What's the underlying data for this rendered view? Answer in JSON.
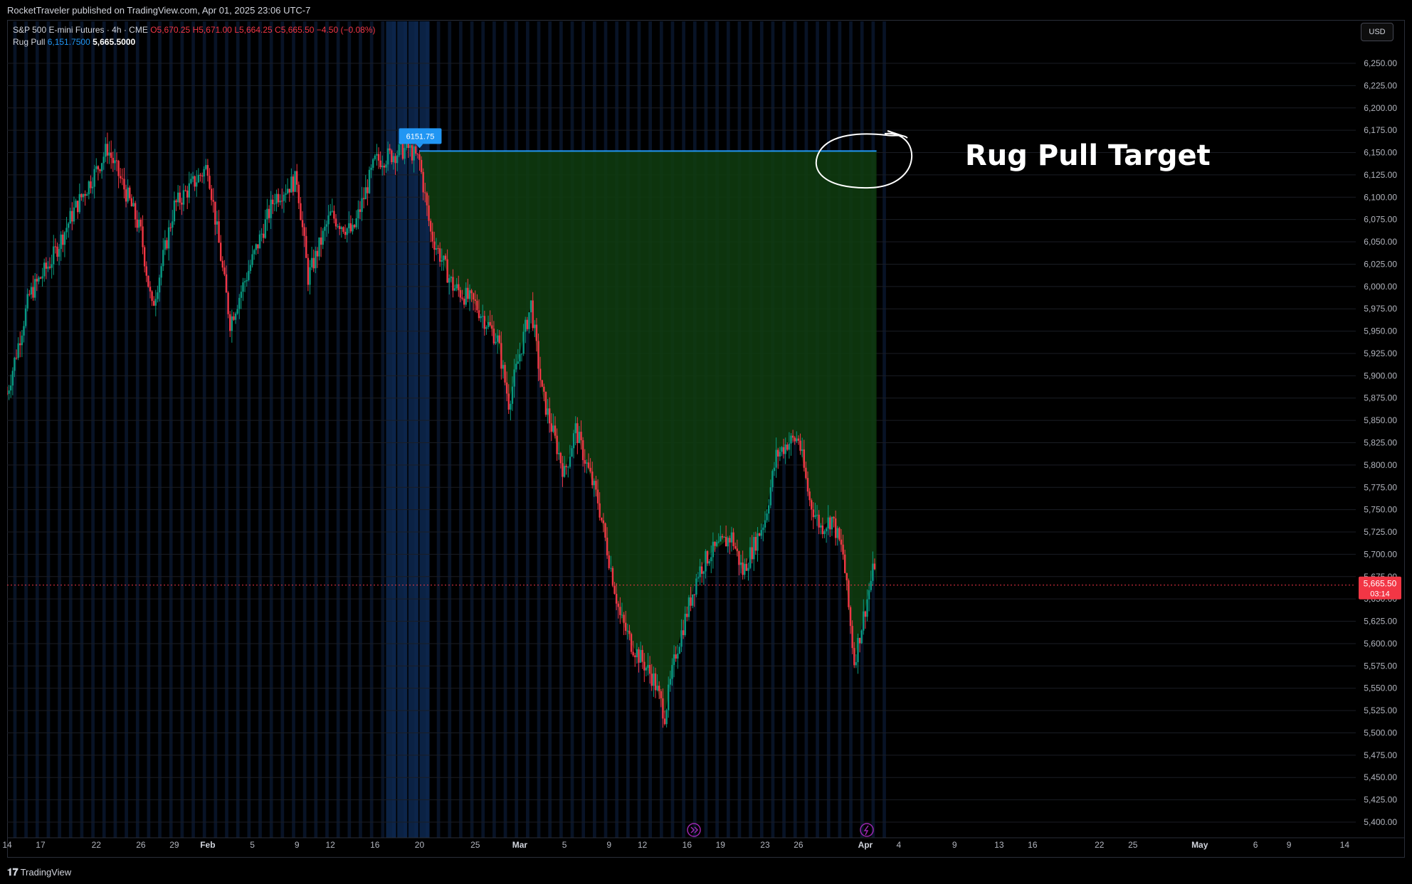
{
  "header": {
    "publish_line": "RocketTraveler published on TradingView.com, Apr 01, 2025 23:06 UTC-7"
  },
  "legend": {
    "symbol": "S&P 500 E-mini Futures · 4h · CME",
    "open": "O5,670.25",
    "high": "H5,671.00",
    "low": "L5,664.25",
    "close": "C5,665.50",
    "change": "−4.50 (−0.08%)",
    "indicator_name": "Rug Pull",
    "indicator_value_1": "6,151.7500",
    "indicator_value_2": "5,665.5000"
  },
  "currency_button": "USD",
  "footer": {
    "logo_text": "TradingView"
  },
  "colors": {
    "up": "#089981",
    "down": "#f23645",
    "level_line": "#2196f3",
    "fill": "#0f3d0f",
    "background": "#000000",
    "bands": "#0b1a33"
  },
  "icons": [
    "replay-icon",
    "lightning-icon",
    "tradingview-logo-icon"
  ],
  "chart_data": {
    "type": "candlestick",
    "symbol": "S&P 500 E-mini Futures",
    "timeframe": "4h",
    "exchange": "CME",
    "y_axis": {
      "ticks": [
        "5,400.00",
        "5,425.00",
        "5,450.00",
        "5,475.00",
        "5,500.00",
        "5,525.00",
        "5,550.00",
        "5,575.00",
        "5,600.00",
        "5,625.00",
        "5,650.00",
        "5,675.00",
        "5,700.00",
        "5,725.00",
        "5,750.00",
        "5,775.00",
        "5,800.00",
        "5,825.00",
        "5,850.00",
        "5,875.00",
        "5,900.00",
        "5,925.00",
        "5,950.00",
        "5,975.00",
        "6,000.00",
        "6,025.00",
        "6,050.00",
        "6,075.00",
        "6,100.00",
        "6,125.00",
        "6,150.00",
        "6,175.00",
        "6,200.00",
        "6,225.00",
        "6,250.00"
      ],
      "range": [
        5392,
        6272
      ],
      "position": "right"
    },
    "x_axis": {
      "ticks": [
        "14",
        "17",
        "22",
        "26",
        "29",
        "Feb",
        "5",
        "9",
        "12",
        "16",
        "20",
        "25",
        "Mar",
        "5",
        "9",
        "12",
        "16",
        "19",
        "23",
        "26",
        "Apr",
        "4",
        "9",
        "13",
        "16",
        "22",
        "25",
        "May",
        "6",
        "9",
        "14"
      ],
      "range_start": "2025-01-14",
      "range_end": "2025-05-15"
    },
    "price_path": [
      {
        "d": "2025-01-14",
        "p": 5880
      },
      {
        "d": "2025-01-16",
        "p": 5990
      },
      {
        "d": "2025-01-18",
        "p": 6030
      },
      {
        "d": "2025-01-20",
        "p": 6085
      },
      {
        "d": "2025-01-22",
        "p": 6130
      },
      {
        "d": "2025-01-23",
        "p": 6155
      },
      {
        "d": "2025-01-25",
        "p": 6095
      },
      {
        "d": "2025-01-26",
        "p": 6060
      },
      {
        "d": "2025-01-27",
        "p": 5975
      },
      {
        "d": "2025-01-29",
        "p": 6090
      },
      {
        "d": "2025-02-01",
        "p": 6135
      },
      {
        "d": "2025-02-03",
        "p": 5960
      },
      {
        "d": "2025-02-05",
        "p": 6030
      },
      {
        "d": "2025-02-07",
        "p": 6100
      },
      {
        "d": "2025-02-09",
        "p": 6120
      },
      {
        "d": "2025-02-10",
        "p": 6010
      },
      {
        "d": "2025-02-12",
        "p": 6080
      },
      {
        "d": "2025-02-14",
        "p": 6060
      },
      {
        "d": "2025-02-16",
        "p": 6140
      },
      {
        "d": "2025-02-19",
        "p": 6155
      },
      {
        "d": "2025-02-20",
        "p": 6140
      },
      {
        "d": "2025-02-21",
        "p": 6060
      },
      {
        "d": "2025-02-23",
        "p": 6000
      },
      {
        "d": "2025-02-25",
        "p": 5980
      },
      {
        "d": "2025-02-27",
        "p": 5940
      },
      {
        "d": "2025-02-28",
        "p": 5870
      },
      {
        "d": "2025-03-02",
        "p": 5980
      },
      {
        "d": "2025-03-03",
        "p": 5880
      },
      {
        "d": "2025-03-05",
        "p": 5790
      },
      {
        "d": "2025-03-06",
        "p": 5840
      },
      {
        "d": "2025-03-08",
        "p": 5760
      },
      {
        "d": "2025-03-10",
        "p": 5630
      },
      {
        "d": "2025-03-11",
        "p": 5600
      },
      {
        "d": "2025-03-13",
        "p": 5560
      },
      {
        "d": "2025-03-14",
        "p": 5520
      },
      {
        "d": "2025-03-15",
        "p": 5590
      },
      {
        "d": "2025-03-17",
        "p": 5680
      },
      {
        "d": "2025-03-18",
        "p": 5700
      },
      {
        "d": "2025-03-20",
        "p": 5720
      },
      {
        "d": "2025-03-21",
        "p": 5680
      },
      {
        "d": "2025-03-23",
        "p": 5740
      },
      {
        "d": "2025-03-24",
        "p": 5810
      },
      {
        "d": "2025-03-25",
        "p": 5825
      },
      {
        "d": "2025-03-26",
        "p": 5830
      },
      {
        "d": "2025-03-27",
        "p": 5760
      },
      {
        "d": "2025-03-28",
        "p": 5730
      },
      {
        "d": "2025-03-29",
        "p": 5740
      },
      {
        "d": "2025-03-30",
        "p": 5700
      },
      {
        "d": "2025-03-31",
        "p": 5580
      },
      {
        "d": "2025-04-01",
        "p": 5640
      },
      {
        "d": "2025-04-01T20",
        "p": 5690
      },
      {
        "d": "2025-04-02",
        "p": 5665.5
      }
    ],
    "rug_pull_level": {
      "value": 6151.75,
      "label": "6151.75",
      "start": "2025-02-20",
      "end": "2025-04-02"
    },
    "current_price": {
      "label": "5,665.50",
      "countdown": "03:14"
    },
    "annotation": "Rug Pull Target"
  }
}
